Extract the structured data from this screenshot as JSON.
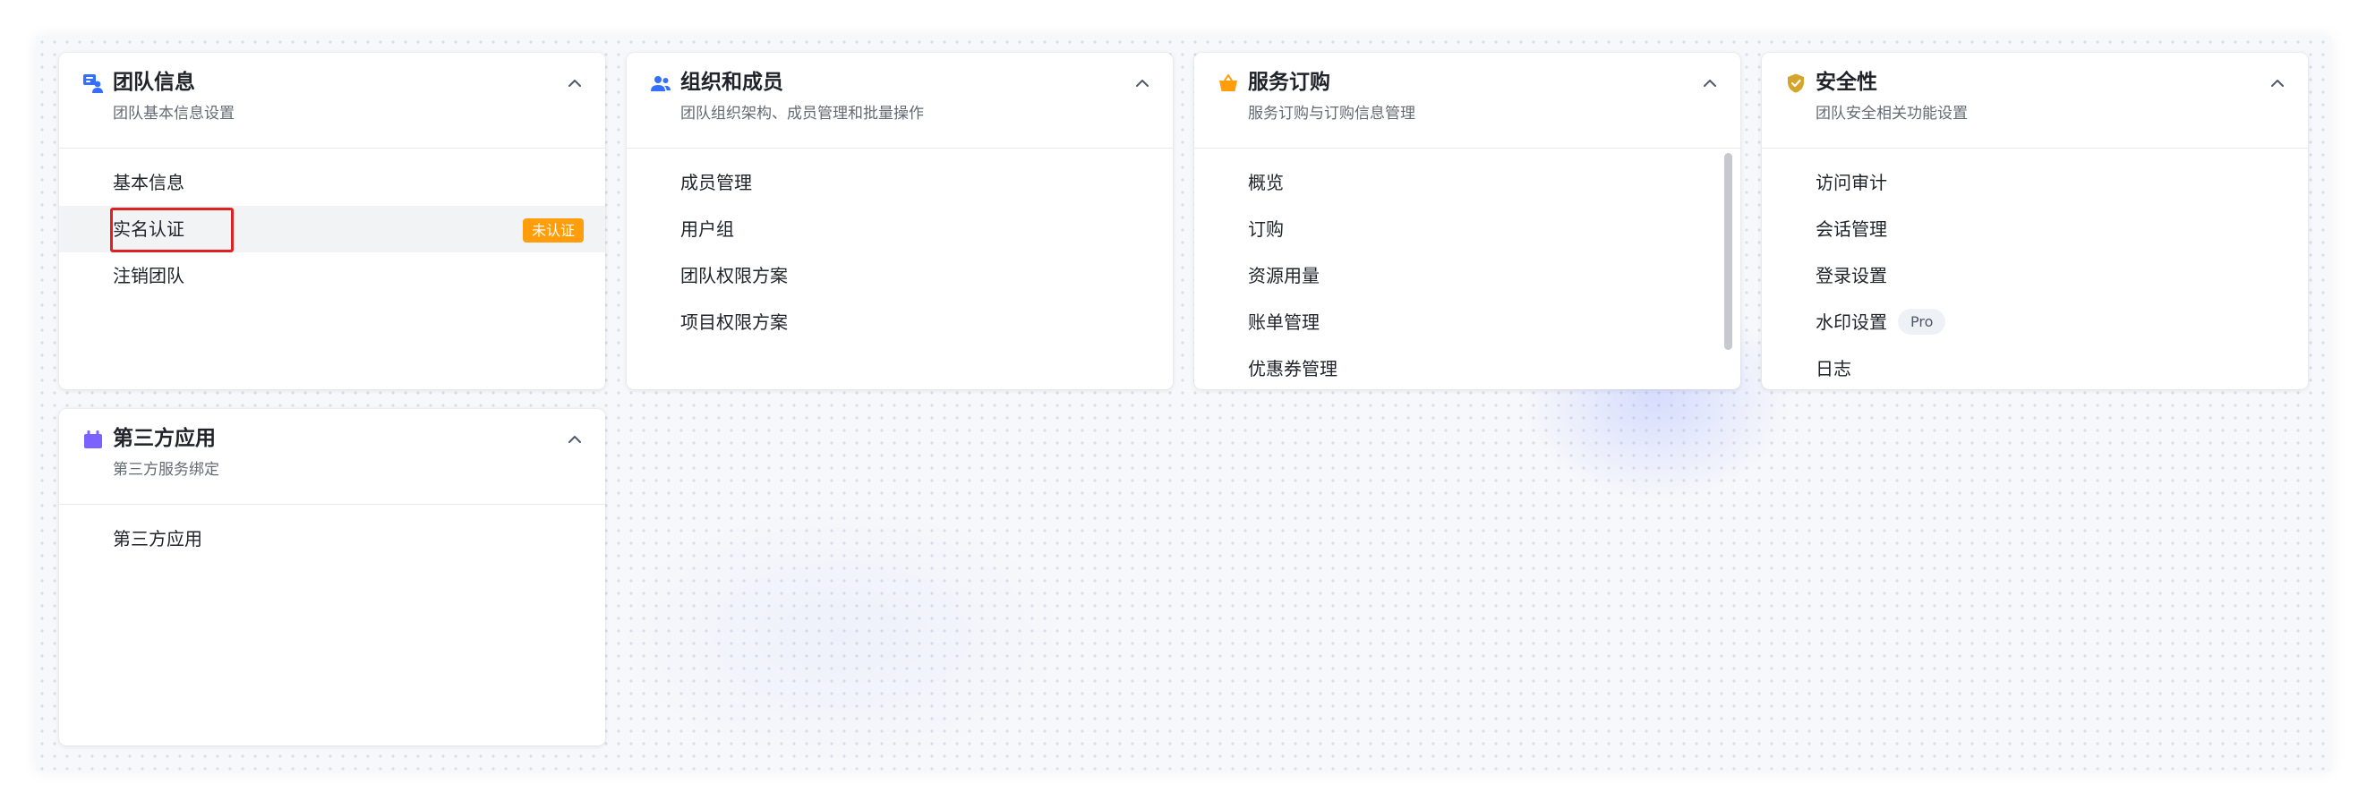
{
  "cards": {
    "team_info": {
      "title": "团队信息",
      "subtitle": "团队基本信息设置",
      "icon": "team-info-icon",
      "items": [
        {
          "label": "基本信息"
        },
        {
          "label": "实名认证",
          "badge": "未认证"
        },
        {
          "label": "注销团队"
        }
      ]
    },
    "org_members": {
      "title": "组织和成员",
      "subtitle": "团队组织架构、成员管理和批量操作",
      "icon": "users-icon",
      "items": [
        {
          "label": "成员管理"
        },
        {
          "label": "用户组"
        },
        {
          "label": "团队权限方案"
        },
        {
          "label": "项目权限方案"
        }
      ]
    },
    "subscription": {
      "title": "服务订购",
      "subtitle": "服务订购与订购信息管理",
      "icon": "shopping-basket-icon",
      "items": [
        {
          "label": "概览"
        },
        {
          "label": "订购"
        },
        {
          "label": "资源用量"
        },
        {
          "label": "账单管理"
        },
        {
          "label": "优惠券管理"
        }
      ]
    },
    "security": {
      "title": "安全性",
      "subtitle": "团队安全相关功能设置",
      "icon": "shield-check-icon",
      "items": [
        {
          "label": "访问审计"
        },
        {
          "label": "会话管理"
        },
        {
          "label": "登录设置"
        },
        {
          "label": "水印设置",
          "badge": "Pro"
        },
        {
          "label": "日志"
        }
      ]
    },
    "third_party": {
      "title": "第三方应用",
      "subtitle": "第三方服务绑定",
      "icon": "app-box-icon",
      "items": [
        {
          "label": "第三方应用"
        }
      ]
    }
  },
  "colors": {
    "blue": "#3370ff",
    "orange": "#ff9d0a",
    "gold": "#d4a52a",
    "purple": "#7b61ff",
    "highlight_red": "#e02020"
  }
}
